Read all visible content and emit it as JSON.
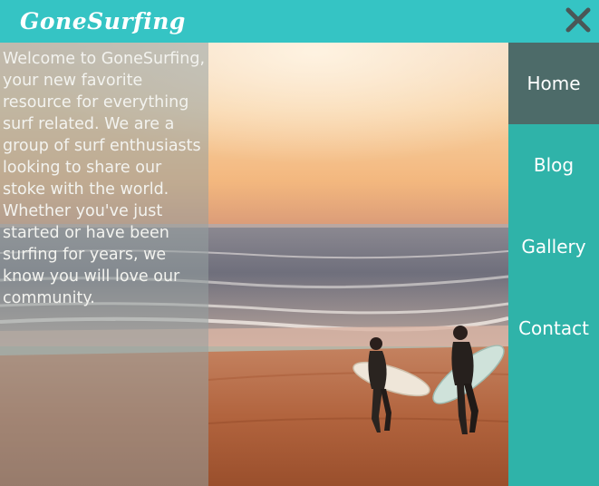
{
  "header": {
    "logo_text": "GoneSurfing",
    "close_icon": "close-x-icon"
  },
  "intro": {
    "text": "Welcome to GoneSurfing, your new favorite resource for everything surf related. We are a group of surf enthusiasts looking to share our stoke with the world. Whether you've just started or have been surfing for years, we know you will love our community."
  },
  "nav": {
    "items": [
      {
        "label": "Home"
      },
      {
        "label": "Blog"
      },
      {
        "label": "Gallery"
      },
      {
        "label": "Contact"
      }
    ],
    "active_index": 0
  },
  "colors": {
    "header_bg": "#35c4c4",
    "nav_bg": "#2fb3a9",
    "nav_active_bg": "#4d6b69",
    "text": "#ffffff"
  }
}
